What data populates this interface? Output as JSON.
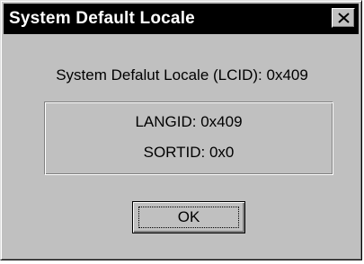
{
  "window": {
    "title": "System Default Locale"
  },
  "icons": {
    "close": "close-icon"
  },
  "content": {
    "lcid_text": "System Defalut Locale (LCID):  0x409",
    "langid_text": "LANGID:  0x409",
    "sortid_text": "SORTID:  0x0"
  },
  "buttons": {
    "ok_label": "OK"
  },
  "colors": {
    "titlebar": "#000000",
    "dialog_bg": "#c0c0c0"
  }
}
